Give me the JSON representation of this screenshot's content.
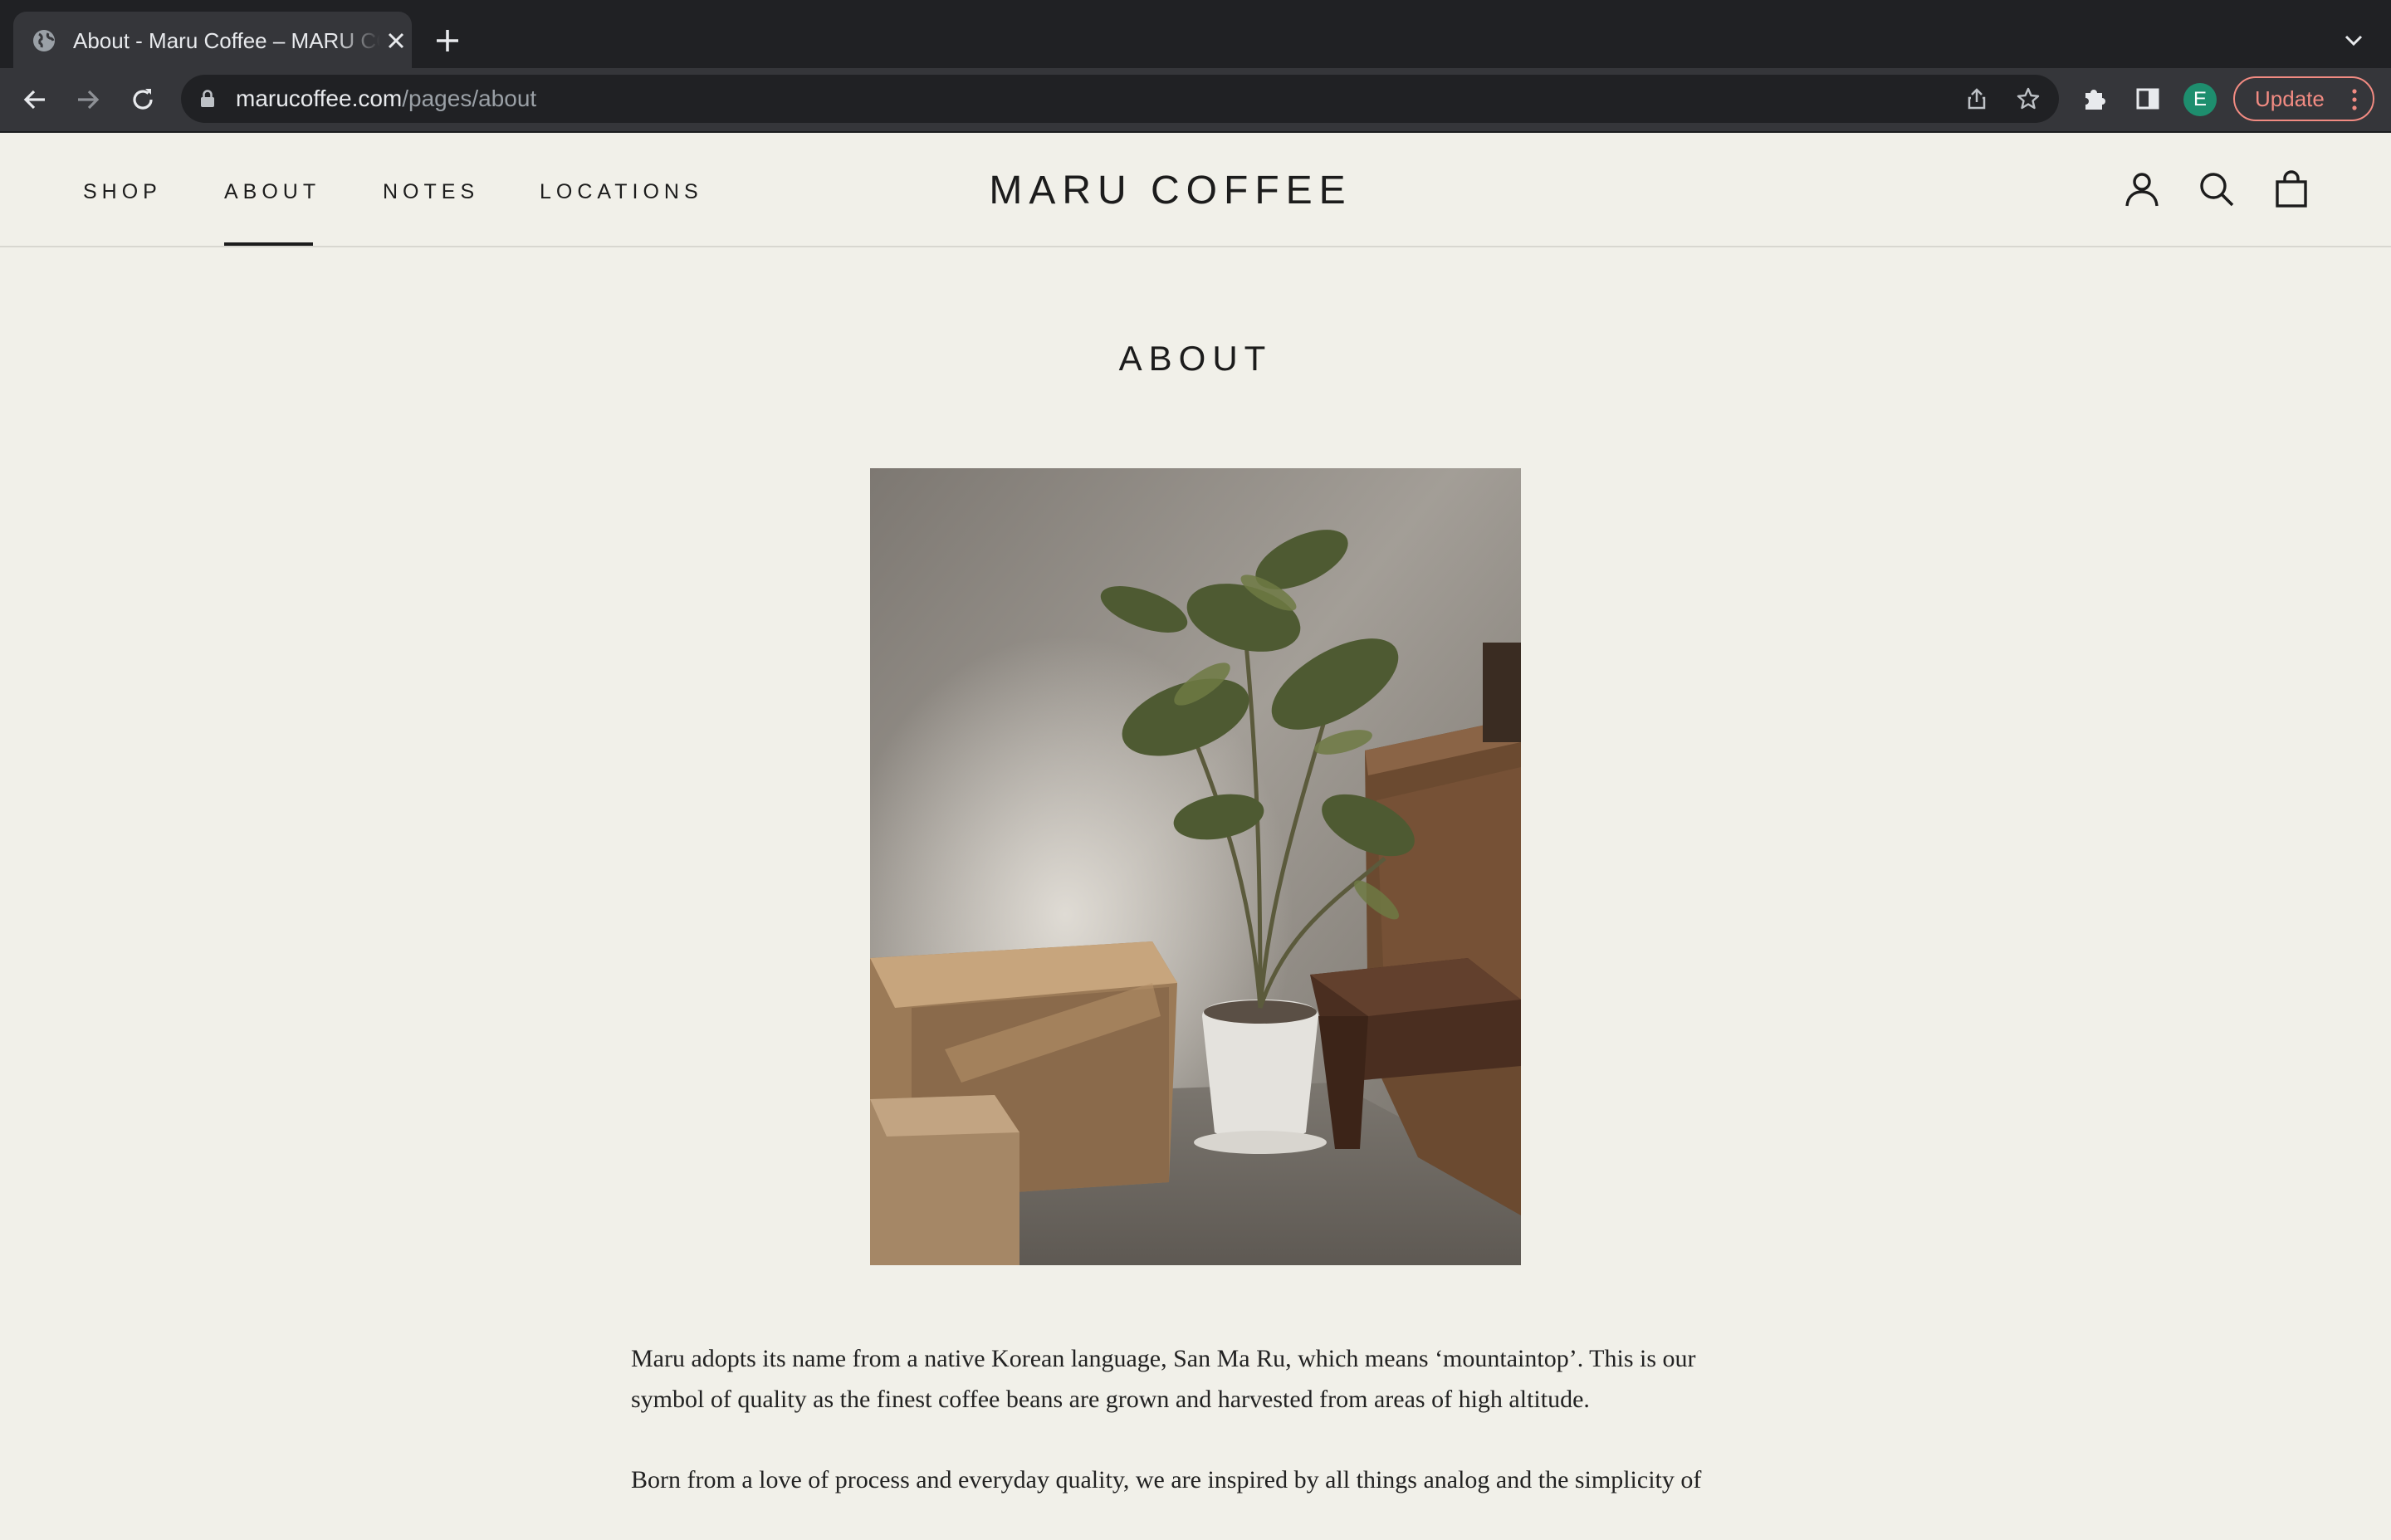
{
  "browser": {
    "tab_title": "About - Maru Coffee – MARU COFFEE",
    "url_host": "marucoffee.com",
    "url_path": "/pages/about",
    "profile_initial": "E",
    "update_label": "Update"
  },
  "site": {
    "logo": "MARU COFFEE",
    "nav": {
      "shop": "SHOP",
      "about": "ABOUT",
      "notes": "NOTES",
      "locations": "LOCATIONS"
    },
    "active_nav": "about"
  },
  "page": {
    "title": "ABOUT",
    "paragraphs": [
      "Maru adopts its name from a native Korean language, San Ma Ru, which means ‘mountaintop’. This is our symbol of quality as the finest coffee beans are grown and harvested from areas of high altitude.",
      "Born from a love of process and everyday quality, we are inspired by all things analog and the simplicity of"
    ]
  },
  "icons": {
    "tab": "globe-icon",
    "account": "account-icon",
    "search": "search-icon",
    "cart": "cart-icon"
  },
  "colors": {
    "page_background": "#f1f0e9",
    "text": "#1c1c1c",
    "chrome_dark": "#202124",
    "chrome_toolbar": "#35363a",
    "update_accent": "#f28b82",
    "avatar": "#1e8e6e"
  }
}
